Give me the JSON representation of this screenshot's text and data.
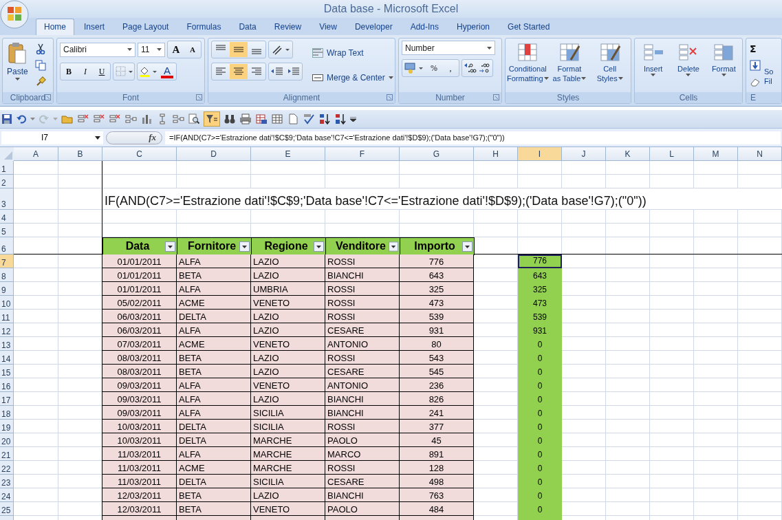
{
  "window": {
    "title": "Data base - Microsoft Excel"
  },
  "tabs": [
    {
      "label": "Home",
      "selected": true
    },
    {
      "label": "Insert",
      "selected": false
    },
    {
      "label": "Page Layout",
      "selected": false
    },
    {
      "label": "Formulas",
      "selected": false
    },
    {
      "label": "Data",
      "selected": false
    },
    {
      "label": "Review",
      "selected": false
    },
    {
      "label": "View",
      "selected": false
    },
    {
      "label": "Developer",
      "selected": false
    },
    {
      "label": "Add-Ins",
      "selected": false
    },
    {
      "label": "Hyperion",
      "selected": false
    },
    {
      "label": "Get Started",
      "selected": false
    }
  ],
  "clipboard": {
    "label": "Clipboard",
    "paste": "Paste"
  },
  "font": {
    "label": "Font",
    "family": "Calibri",
    "size": "11",
    "grow": "A",
    "shrink": "A",
    "bold": "B",
    "italic": "I",
    "underline": "U",
    "font_color": "A"
  },
  "alignment": {
    "label": "Alignment",
    "vertical": [
      {
        "selected": false
      },
      {
        "selected": true
      },
      {
        "selected": false
      }
    ],
    "horizontal": [
      {
        "selected": false
      },
      {
        "selected": true
      },
      {
        "selected": false
      }
    ],
    "wrap_text": "Wrap Text",
    "merge": "Merge & Center"
  },
  "number": {
    "label": "Number",
    "format": "Number",
    "percent": "%",
    "comma": ","
  },
  "styles": {
    "label": "Styles",
    "buttons": [
      {
        "lines": [
          "Conditional",
          "Formatting"
        ]
      },
      {
        "lines": [
          "Format",
          "as Table"
        ]
      },
      {
        "lines": [
          "Cell",
          "Styles"
        ]
      }
    ]
  },
  "cells": {
    "label": "Cells",
    "buttons": [
      "Insert",
      "Delete",
      "Format"
    ]
  },
  "editing": {
    "label": "E",
    "sum": "Σ",
    "button": [
      "So",
      "Fil"
    ]
  },
  "quick_access": {
    "autofilter_selected": true
  },
  "formula_bar": {
    "name_box": "I7",
    "fx": "fx",
    "formula": "=IF(AND(C7>='Estrazione dati'!$C$9;'Data base'!C7<='Estrazione dati'!$D$9);('Data base'!G7);(\"0\"))"
  },
  "sheet": {
    "columns": [
      {
        "label": "A",
        "selected": false
      },
      {
        "label": "B",
        "selected": false
      },
      {
        "label": "C",
        "selected": false
      },
      {
        "label": "D",
        "selected": false
      },
      {
        "label": "E",
        "selected": false
      },
      {
        "label": "F",
        "selected": false
      },
      {
        "label": "G",
        "selected": false
      },
      {
        "label": "H",
        "selected": false
      },
      {
        "label": "I",
        "selected": true
      },
      {
        "label": "J",
        "selected": false
      },
      {
        "label": "K",
        "selected": false
      },
      {
        "label": "L",
        "selected": false
      },
      {
        "label": "M",
        "selected": false
      },
      {
        "label": "N",
        "selected": false
      }
    ],
    "rows": [
      {
        "label": "1",
        "selected": false
      },
      {
        "label": "2",
        "selected": false
      },
      {
        "label": "3",
        "selected": false
      },
      {
        "label": "4",
        "selected": false
      },
      {
        "label": "5",
        "selected": false
      },
      {
        "label": "6",
        "selected": false
      },
      {
        "label": "7",
        "selected": true
      },
      {
        "label": "8",
        "selected": false
      },
      {
        "label": "9",
        "selected": false
      },
      {
        "label": "10",
        "selected": false
      },
      {
        "label": "11",
        "selected": false
      },
      {
        "label": "12",
        "selected": false
      },
      {
        "label": "13",
        "selected": false
      },
      {
        "label": "14",
        "selected": false
      },
      {
        "label": "15",
        "selected": false
      },
      {
        "label": "16",
        "selected": false
      },
      {
        "label": "17",
        "selected": false
      },
      {
        "label": "18",
        "selected": false
      },
      {
        "label": "19",
        "selected": false
      },
      {
        "label": "20",
        "selected": false
      },
      {
        "label": "21",
        "selected": false
      },
      {
        "label": "22",
        "selected": false
      },
      {
        "label": "23",
        "selected": false
      },
      {
        "label": "24",
        "selected": false
      },
      {
        "label": "25",
        "selected": false
      }
    ],
    "note": "IF(AND(C7>='Estrazione dati'!$C$9;'Data base'!C7<='Estrazione dati'!$D$9);('Data base'!G7);(\"0\"))",
    "table": {
      "headers": [
        "Data",
        "Fornitore",
        "Regione",
        "Venditore",
        "Importo"
      ],
      "rows": [
        [
          "01/01/2011",
          "ALFA",
          "LAZIO",
          "ROSSI",
          "776"
        ],
        [
          "01/01/2011",
          "BETA",
          "LAZIO",
          "BIANCHI",
          "643"
        ],
        [
          "01/01/2011",
          "ALFA",
          "UMBRIA",
          "ROSSI",
          "325"
        ],
        [
          "05/02/2011",
          "ACME",
          "VENETO",
          "ROSSI",
          "473"
        ],
        [
          "06/03/2011",
          "DELTA",
          "LAZIO",
          "ROSSI",
          "539"
        ],
        [
          "06/03/2011",
          "ALFA",
          "LAZIO",
          "CESARE",
          "931"
        ],
        [
          "07/03/2011",
          "ACME",
          "VENETO",
          "ANTONIO",
          "80"
        ],
        [
          "08/03/2011",
          "BETA",
          "LAZIO",
          "ROSSI",
          "543"
        ],
        [
          "08/03/2011",
          "BETA",
          "LAZIO",
          "CESARE",
          "545"
        ],
        [
          "09/03/2011",
          "ALFA",
          "VENETO",
          "ANTONIO",
          "236"
        ],
        [
          "09/03/2011",
          "ALFA",
          "LAZIO",
          "BIANCHI",
          "826"
        ],
        [
          "09/03/2011",
          "ALFA",
          "SICILIA",
          "BIANCHI",
          "241"
        ],
        [
          "10/03/2011",
          "DELTA",
          "SICILIA",
          "ROSSI",
          "377"
        ],
        [
          "10/03/2011",
          "DELTA",
          "MARCHE",
          "PAOLO",
          "45"
        ],
        [
          "11/03/2011",
          "ALFA",
          "MARCHE",
          "MARCO",
          "891"
        ],
        [
          "11/03/2011",
          "ACME",
          "MARCHE",
          "ROSSI",
          "128"
        ],
        [
          "11/03/2011",
          "DELTA",
          "SICILIA",
          "CESARE",
          "498"
        ],
        [
          "12/03/2011",
          "BETA",
          "LAZIO",
          "BIANCHI",
          "763"
        ],
        [
          "12/03/2011",
          "BETA",
          "VENETO",
          "PAOLO",
          "484"
        ]
      ]
    },
    "results": [
      {
        "value": "776",
        "selected": true
      },
      {
        "value": "643",
        "selected": false
      },
      {
        "value": "325",
        "selected": false
      },
      {
        "value": "473",
        "selected": false
      },
      {
        "value": "539",
        "selected": false
      },
      {
        "value": "931",
        "selected": false
      },
      {
        "value": "0",
        "selected": false
      },
      {
        "value": "0",
        "selected": false
      },
      {
        "value": "0",
        "selected": false
      },
      {
        "value": "0",
        "selected": false
      },
      {
        "value": "0",
        "selected": false
      },
      {
        "value": "0",
        "selected": false
      },
      {
        "value": "0",
        "selected": false
      },
      {
        "value": "0",
        "selected": false
      },
      {
        "value": "0",
        "selected": false
      },
      {
        "value": "0",
        "selected": false
      },
      {
        "value": "0",
        "selected": false
      },
      {
        "value": "0",
        "selected": false
      },
      {
        "value": "0",
        "selected": false
      }
    ]
  }
}
